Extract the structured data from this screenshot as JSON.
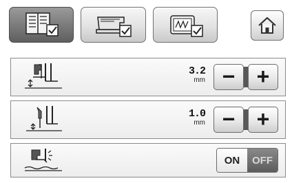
{
  "tabs": [
    {
      "icon": "page-settings-icon",
      "selected": true
    },
    {
      "icon": "sewing-machine-icon",
      "selected": false
    },
    {
      "icon": "embroidery-hoop-icon",
      "selected": false
    }
  ],
  "home": {
    "icon": "home-icon"
  },
  "settings": {
    "zigzag_width": {
      "icon": "presser-foot-width-icon",
      "value": "3.2",
      "unit": "mm",
      "minus": "−",
      "plus": "+"
    },
    "stitch_length": {
      "icon": "needle-length-icon",
      "value": "1.0",
      "unit": "mm",
      "minus": "−",
      "plus": "+"
    },
    "pivot": {
      "icon": "presser-foot-lift-icon",
      "on_label": "ON",
      "off_label": "OFF",
      "state": "OFF"
    }
  },
  "colors": {
    "active_tab": "#7c7c7c",
    "toggle_off": "#5c5c5c"
  }
}
